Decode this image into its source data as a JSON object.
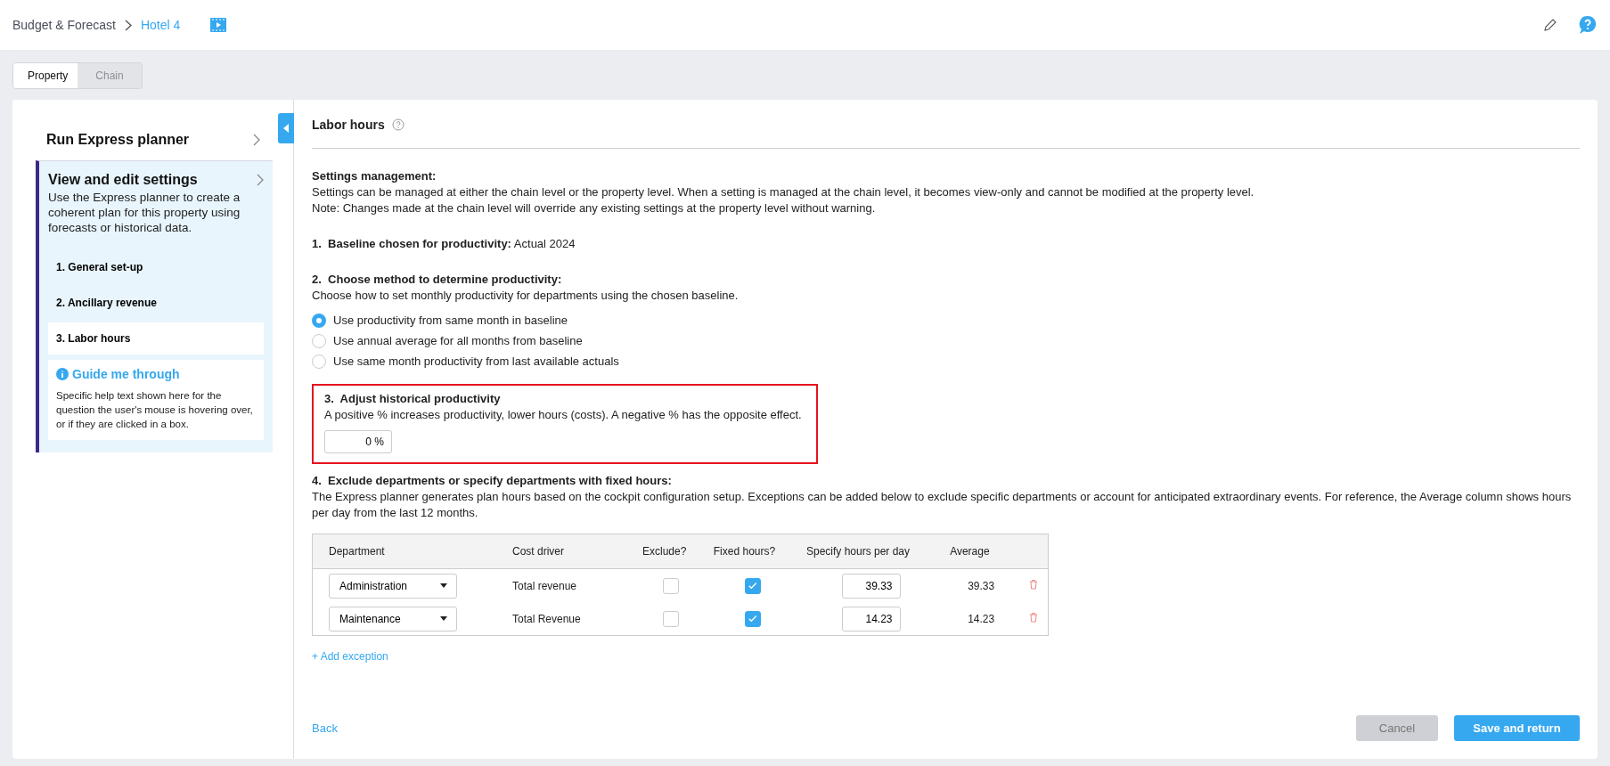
{
  "breadcrumb": {
    "parent": "Budget & Forecast",
    "current": "Hotel 4"
  },
  "tabs": [
    {
      "label": "Property",
      "selected": true
    },
    {
      "label": "Chain",
      "selected": false
    }
  ],
  "sidebar": {
    "items": [
      {
        "title": "Run Express planner",
        "expanded": false
      },
      {
        "title": "View and edit settings",
        "expanded": true,
        "description": "Use the Express planner to create a coherent plan for this property using forecasts or historical data.",
        "steps": [
          {
            "label": "1. General set-up",
            "selected": false
          },
          {
            "label": "2. Ancillary revenue",
            "selected": false
          },
          {
            "label": "3. Labor hours",
            "selected": true
          }
        ],
        "guide": {
          "title": "Guide me through",
          "text": "Specific help text shown here for the question the user's mouse is hovering over, or if they are clicked in a box."
        }
      }
    ]
  },
  "page_title": "Labor hours",
  "settings": {
    "heading": "Settings management:",
    "lines": [
      "Settings can be managed at either the chain level or the property level. When a setting is managed at the chain level, it becomes view-only and cannot be modified at the property level.",
      "Note: Changes made at the chain level will override any existing settings at the property level without warning."
    ]
  },
  "baseline": {
    "number": "1.",
    "label": "Baseline chosen for productivity:",
    "value": "Actual 2024"
  },
  "method": {
    "number": "2.",
    "heading": "Choose method to determine productivity:",
    "text": "Choose how to set monthly productivity for departments using the chosen baseline.",
    "options": [
      {
        "label": "Use productivity from same month in baseline",
        "selected": true
      },
      {
        "label": "Use annual average for all months from baseline",
        "selected": false
      },
      {
        "label": "Use same month productivity from last available actuals",
        "selected": false
      }
    ]
  },
  "adjust": {
    "number": "3.",
    "heading": "Adjust historical productivity",
    "text": "A positive % increases productivity, lower hours (costs). A negative % has the opposite effect.",
    "value": "0 %",
    "highlighted": true
  },
  "exclude": {
    "number": "4.",
    "heading": "Exclude departments or specify departments with fixed hours:",
    "text": "The Express planner generates plan hours based on the cockpit configuration setup. Exceptions can be added below to exclude specific departments or account for anticipated extraordinary events. For reference, the Average column shows hours per day from the last 12 months.",
    "table": {
      "columns": [
        "Department",
        "Cost driver",
        "Exclude?",
        "Fixed hours?",
        "Specify hours per day",
        "Average"
      ],
      "rows": [
        {
          "department": "Administration",
          "cost_driver": "Total revenue",
          "exclude": false,
          "fixed": true,
          "hours": "39.33",
          "average": "39.33"
        },
        {
          "department": "Maintenance",
          "cost_driver": "Total Revenue",
          "exclude": false,
          "fixed": true,
          "hours": "14.23",
          "average": "14.23"
        }
      ]
    },
    "add_label": "+ Add exception"
  },
  "footer": {
    "back": "Back",
    "cancel": {
      "label": "Cancel",
      "disabled": true
    },
    "save": {
      "label": "Save and return",
      "disabled": false
    }
  }
}
